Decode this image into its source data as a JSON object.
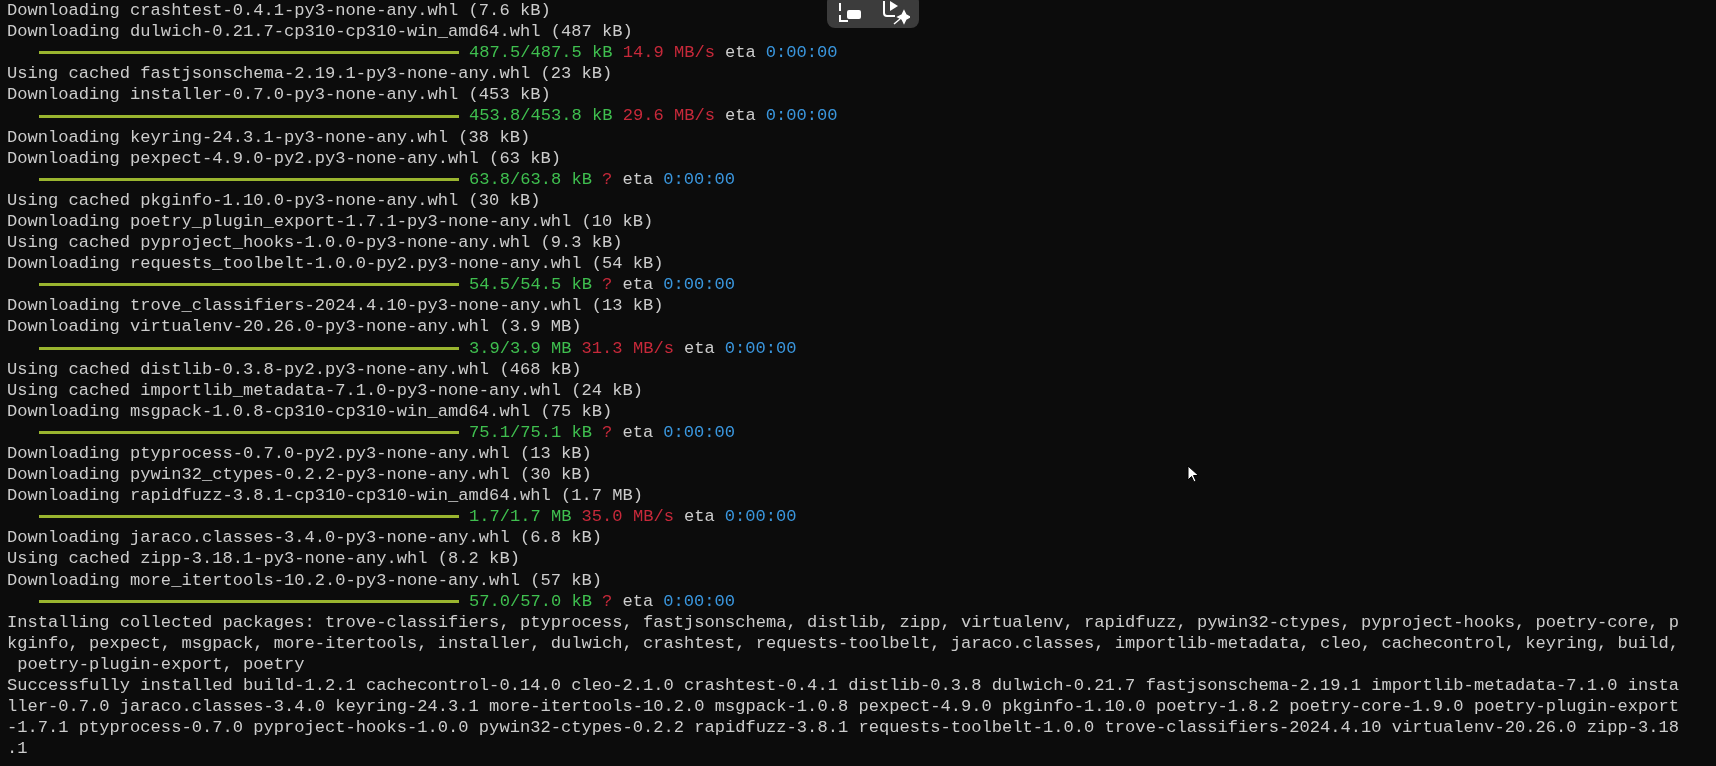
{
  "terminal": {
    "lines": [
      {
        "kind": "text",
        "text": "Downloading crashtest-0.4.1-py3-none-any.whl (7.6 kB)"
      },
      {
        "kind": "text",
        "text": "Downloading dulwich-0.21.7-cp310-cp310-win_amd64.whl (487 kB)"
      },
      {
        "kind": "progress",
        "level": 1,
        "amount": "487.5/487.5 kB",
        "speed": "14.9 MB/s",
        "eta_label": "eta",
        "eta": "0:00:00"
      },
      {
        "kind": "text",
        "text": "Using cached fastjsonschema-2.19.1-py3-none-any.whl (23 kB)"
      },
      {
        "kind": "text",
        "text": "Downloading installer-0.7.0-py3-none-any.whl (453 kB)"
      },
      {
        "kind": "progress",
        "level": 1,
        "amount": "453.8/453.8 kB",
        "speed": "29.6 MB/s",
        "eta_label": "eta",
        "eta": "0:00:00"
      },
      {
        "kind": "text",
        "text": "Downloading keyring-24.3.1-py3-none-any.whl (38 kB)"
      },
      {
        "kind": "text",
        "text": "Downloading pexpect-4.9.0-py2.py3-none-any.whl (63 kB)"
      },
      {
        "kind": "progress",
        "level": 1,
        "amount": "63.8/63.8 kB",
        "speed": "?",
        "eta_label": "eta",
        "eta": "0:00:00"
      },
      {
        "kind": "text",
        "text": "Using cached pkginfo-1.10.0-py3-none-any.whl (30 kB)"
      },
      {
        "kind": "text",
        "text": "Downloading poetry_plugin_export-1.7.1-py3-none-any.whl (10 kB)"
      },
      {
        "kind": "text",
        "text": "Using cached pyproject_hooks-1.0.0-py3-none-any.whl (9.3 kB)"
      },
      {
        "kind": "text",
        "text": "Downloading requests_toolbelt-1.0.0-py2.py3-none-any.whl (54 kB)"
      },
      {
        "kind": "progress",
        "level": 1,
        "amount": "54.5/54.5 kB",
        "speed": "?",
        "eta_label": "eta",
        "eta": "0:00:00"
      },
      {
        "kind": "text",
        "text": "Downloading trove_classifiers-2024.4.10-py3-none-any.whl (13 kB)"
      },
      {
        "kind": "text",
        "text": "Downloading virtualenv-20.26.0-py3-none-any.whl (3.9 MB)"
      },
      {
        "kind": "progress",
        "level": 1,
        "amount": "3.9/3.9 MB",
        "speed": "31.3 MB/s",
        "eta_label": "eta",
        "eta": "0:00:00"
      },
      {
        "kind": "text",
        "text": "Using cached distlib-0.3.8-py2.py3-none-any.whl (468 kB)"
      },
      {
        "kind": "text",
        "text": "Using cached importlib_metadata-7.1.0-py3-none-any.whl (24 kB)"
      },
      {
        "kind": "text",
        "text": "Downloading msgpack-1.0.8-cp310-cp310-win_amd64.whl (75 kB)"
      },
      {
        "kind": "progress",
        "level": 1,
        "amount": "75.1/75.1 kB",
        "speed": "?",
        "eta_label": "eta",
        "eta": "0:00:00"
      },
      {
        "kind": "text",
        "text": "Downloading ptyprocess-0.7.0-py2.py3-none-any.whl (13 kB)"
      },
      {
        "kind": "text",
        "text": "Downloading pywin32_ctypes-0.2.2-py3-none-any.whl (30 kB)"
      },
      {
        "kind": "text",
        "text": "Downloading rapidfuzz-3.8.1-cp310-cp310-win_amd64.whl (1.7 MB)"
      },
      {
        "kind": "progress",
        "level": 1,
        "amount": "1.7/1.7 MB",
        "speed": "35.0 MB/s",
        "eta_label": "eta",
        "eta": "0:00:00"
      },
      {
        "kind": "text",
        "text": "Downloading jaraco.classes-3.4.0-py3-none-any.whl (6.8 kB)"
      },
      {
        "kind": "text",
        "text": "Using cached zipp-3.18.1-py3-none-any.whl (8.2 kB)"
      },
      {
        "kind": "text",
        "text": "Downloading more_itertools-10.2.0-py3-none-any.whl (57 kB)"
      },
      {
        "kind": "progress",
        "level": 1,
        "amount": "57.0/57.0 kB",
        "speed": "?",
        "eta_label": "eta",
        "eta": "0:00:00"
      },
      {
        "kind": "text",
        "text": "Installing collected packages: trove-classifiers, ptyprocess, fastjsonschema, distlib, zipp, virtualenv, rapidfuzz, pywin32-ctypes, pyproject-hooks, poetry-core, p"
      },
      {
        "kind": "text",
        "text": "kginfo, pexpect, msgpack, more-itertools, installer, dulwich, crashtest, requests-toolbelt, jaraco.classes, importlib-metadata, cleo, cachecontrol, keyring, build,"
      },
      {
        "kind": "text",
        "text": " poetry-plugin-export, poetry"
      },
      {
        "kind": "text",
        "text": "Successfully installed build-1.2.1 cachecontrol-0.14.0 cleo-2.1.0 crashtest-0.4.1 distlib-0.3.8 dulwich-0.21.7 fastjsonschema-2.19.1 importlib-metadata-7.1.0 insta"
      },
      {
        "kind": "text",
        "text": "ller-0.7.0 jaraco.classes-3.4.0 keyring-24.3.1 more-itertools-10.2.0 msgpack-1.0.8 pexpect-4.9.0 pkginfo-1.10.0 poetry-1.8.2 poetry-core-1.9.0 poetry-plugin-export"
      },
      {
        "kind": "text",
        "text": "-1.7.1 ptyprocess-0.7.0 pyproject-hooks-1.0.0 pywin32-ctypes-0.2.2 rapidfuzz-3.8.1 requests-toolbelt-1.0.0 trove-classifiers-2024.4.10 virtualenv-20.26.0 zipp-3.18"
      },
      {
        "kind": "text",
        "text": ".1"
      }
    ]
  }
}
